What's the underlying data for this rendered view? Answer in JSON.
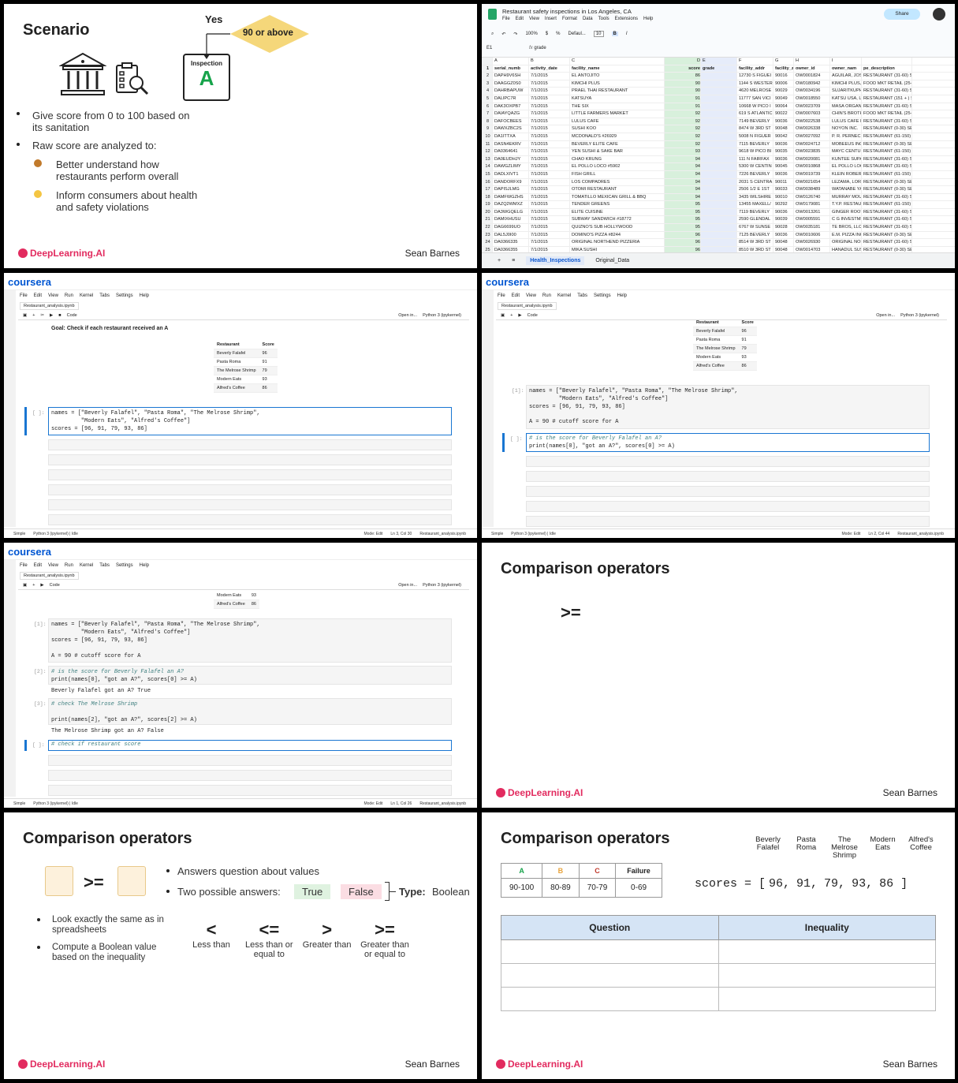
{
  "scenario": {
    "title": "Scenario",
    "yes": "Yes",
    "threshold": "90 or above",
    "inspection": "Inspection",
    "grade": "A",
    "bullets": [
      "Give score from 0 to 100 based on its sanitation",
      "Raw score are analyzed to:"
    ],
    "sub_bullets": [
      "Better understand how restaurants perform overall",
      "Inform consumers about health and safety violations"
    ],
    "logo": "DeepLearning.AI",
    "author": "Sean Barnes"
  },
  "sheet": {
    "title": "Restaurant safety inspections in Los Angeles, CA",
    "menu": [
      "File",
      "Edit",
      "View",
      "Insert",
      "Format",
      "Data",
      "Tools",
      "Extensions",
      "Help"
    ],
    "share": "Share",
    "zoom": "100%",
    "font": "Defaul...",
    "font_size": "10",
    "cell_ref": "E1",
    "formula": "grade",
    "col_letters": [
      "A",
      "B",
      "C",
      "D",
      "E",
      "F",
      "G",
      "H",
      "I"
    ],
    "headers": [
      "serial_numb",
      "activity_date",
      "facility_name",
      "score",
      "grade",
      "facility_addr",
      "facility_zip",
      "owner_id",
      "owner_nam",
      "pe_description"
    ],
    "rows": [
      [
        "DAPH9V6SH",
        "7/1/2015",
        "EL ANTOJITO",
        "86",
        "",
        "12730 S FIGUEI",
        "90016",
        "OW0001824",
        "AGUILAR, JOSE",
        "RESTAURANT (31-60) SEA"
      ],
      [
        "DAAGGZ0S0",
        "7/1/2015",
        "KIMCHI PLUS",
        "90",
        "",
        "1144 S WESTER",
        "90006",
        "OW0180942",
        "KIMCHI PLUS, I",
        "FOOD MKT RETAIL (25-1,9"
      ],
      [
        "DAHRBAPUW",
        "7/1/2015",
        "PRAEL THAI RESTAURANT",
        "90",
        "",
        "4620 MELROSE",
        "90029",
        "OW0034196",
        "SUJARITKUPH",
        "RESTAURANT (31-60) SEA"
      ],
      [
        "DALIPC7R",
        "7/1/2015",
        "KATSUYA",
        "91",
        "",
        "11777 SAN VICI",
        "90049",
        "OW0018550",
        "KATSU USA, LL",
        "RESTAURANT (151 + ) SE"
      ],
      [
        "DAK3OXPB7",
        "7/1/2015",
        "THE SIX",
        "91",
        "",
        "10668 W PICO I",
        "90064",
        "OW0023709",
        "MASA ORGANI",
        "RESTAURANT (31-60) SEA"
      ],
      [
        "DAIAYQAZG",
        "7/1/2015",
        "LITTLE FARMERS MARKET",
        "92",
        "",
        "619 S ATLANTIC",
        "90022",
        "OW0007603",
        "CHIN'S BROTHI",
        "FOOD MKT RETAIL (25-1,9"
      ],
      [
        "DAFOCBEES",
        "7/1/2015",
        "LULUS CAFE",
        "92",
        "",
        "7149 BEVERLY",
        "90036",
        "OW0022538",
        "LULUS CAFE IN",
        "RESTAURANT (31-60) SEA"
      ],
      [
        "DAWXZBC2S",
        "7/1/2015",
        "SUSHI KOO",
        "92",
        "",
        "8474 W 3RD ST",
        "90048",
        "OW0026338",
        "NOYON INC.",
        "RESTAURANT (0-30) SEAT"
      ],
      [
        "DA1ITTXA",
        "7/1/2015",
        "MCDONALD'S #26929",
        "92",
        "",
        "5008 N FIGUER",
        "90042",
        "OW0027092",
        "P. R. PERNECK",
        "RESTAURANT (61-150) SE"
      ],
      [
        "DASN4EKRV",
        "7/1/2015",
        "BEVERLY ELITE CAFE",
        "92",
        "",
        "7115 BEVERLY",
        "90036",
        "OW0024712",
        "MOBEEUS INC.",
        "RESTAURANT (0-30) SEAT"
      ],
      [
        "DA0364641",
        "7/1/2015",
        "YEN SUSHI & SAKE BAR",
        "93",
        "",
        "9618 W PICO BI",
        "90035",
        "OW0023835",
        "MAYC CENTUR",
        "RESTAURANT (61-150) SE"
      ],
      [
        "DA0EUDHJY",
        "7/1/2015",
        "CHAO KRUNG",
        "94",
        "",
        "111 N FAIRFAX",
        "90036",
        "OW0020081",
        "KUNTEE SUPA",
        "RESTAURANT (31-60) SEA"
      ],
      [
        "DAWGZLIMY",
        "7/1/2015",
        "EL POLLO LOCO #5902",
        "94",
        "",
        "5300 W CENTIN",
        "90045",
        "OW0010868",
        "EL POLLO LOC",
        "RESTAURANT (31-60) SEA"
      ],
      [
        "DADLXIVT1",
        "7/1/2015",
        "FISH GRILL",
        "94",
        "",
        "7226 BEVERLY",
        "90036",
        "OW0019739",
        "KLEIN ROBERT",
        "RESTAURANT (61-150) SE"
      ],
      [
        "DANDORFX9",
        "7/1/2015",
        "LOS COMPADRES",
        "94",
        "",
        "2031 S CENTRA",
        "90011",
        "OW0021654",
        "LEZAMA, LORE",
        "RESTAURANT (0-30) SEAT"
      ],
      [
        "DAPISJLMG",
        "7/1/2015",
        "OTOMI RESTAURANT",
        "94",
        "",
        "2506 1/2 E 1ST",
        "90033",
        "OW0038489",
        "WATANABE YAS",
        "RESTAURANT (0-30) SEAT"
      ],
      [
        "DAMFWGZHS",
        "7/1/2015",
        "TOMATILLO MEXICAN GRILL & BBQ",
        "94",
        "",
        "3435 WILSHIRE",
        "90010",
        "OW0126740",
        "MURRAY MOUI",
        "RESTAURANT (31-60) SEA"
      ],
      [
        "DAZQ2WMXZ",
        "7/1/2015",
        "TENDER GREENS",
        "95",
        "",
        "13455 MAXELL/",
        "90292",
        "OW0179081",
        "T.Y.P. RESTAUR",
        "RESTAURANT (61-150) SE"
      ],
      [
        "DA3WGQELG",
        "7/1/2015",
        "ELITE CUISINE",
        "95",
        "",
        "7119 BEVERLY",
        "90036",
        "OW0013261",
        "GINGER ROOT",
        "RESTAURANT (31-60) SEA"
      ],
      [
        "DAMIXHUSU",
        "7/1/2015",
        "SUBWAY SANDWICH #18772",
        "95",
        "",
        "2590 GLENDAL",
        "90039",
        "OW0005591",
        "C G INVESTME",
        "RESTAURANT (31-60) SEA"
      ],
      [
        "DAG6699UO",
        "7/1/2015",
        "QUIZNO'S SUB HOLLYWOOD",
        "95",
        "",
        "6767 W SUNSE",
        "90028",
        "OW0035181",
        "TE BROS, LLC",
        "RESTAURANT (31-60) SEA"
      ],
      [
        "DAL5J0I00",
        "7/1/2015",
        "DOMINO'S PIZZA #8244",
        "96",
        "",
        "7125 BEVERLY",
        "90036",
        "OW0010606",
        "E.M. PIZZA INC",
        "RESTAURANT (0-30) SEAT"
      ],
      [
        "DA0366335",
        "7/1/2015",
        "ORIGINAL NORTHEND PIZZERIA",
        "96",
        "",
        "8514 W 3RD ST",
        "90048",
        "OW0026930",
        "ORIGINAL NOR",
        "RESTAURANT (31-60) SEA"
      ],
      [
        "DA0366355",
        "7/1/2015",
        "MIKA SUSHI",
        "96",
        "",
        "8510 W 3RD ST",
        "90048",
        "OW0014703",
        "HANADUL SUSI",
        "RESTAURANT (0-30) SEAT"
      ]
    ],
    "tabs": [
      "Health_Inspections",
      "Original_Data"
    ]
  },
  "jupyter": {
    "brand": "coursera",
    "menu": [
      "File",
      "Edit",
      "View",
      "Run",
      "Kernel",
      "Tabs",
      "Settings",
      "Help"
    ],
    "tab": "Restaurant_analysis.ipynb",
    "cell_type": "Code",
    "kernel": "Python 3 (ipykernel)",
    "open_in": "Open in...",
    "status_simple": "Simple",
    "status_kernel": "Python 3 (ipykernel) | Idle",
    "status_mode": "Mode: Edit",
    "status_file": "Restaurant_analysis.ipynb",
    "goal": "Goal: Check if each restaurant received an A",
    "table_head": [
      "Restaurant",
      "Score"
    ],
    "table_rows": [
      [
        "Beverly Falafel",
        "96"
      ],
      [
        "Pasta Roma",
        "91"
      ],
      [
        "The Melrose Shrimp",
        "79"
      ],
      [
        "Modern Eats",
        "93"
      ],
      [
        "Alfred's Coffee",
        "86"
      ]
    ],
    "p3_pos": "Ln 3, Col 30",
    "p4_pos": "Ln 2, Col 44",
    "p5_pos": "Ln 1, Col 26",
    "code_names1": "names = [\"Beverly Falafel\", \"Pasta Roma\", \"The Melrose Shrimp\",",
    "code_names2": "         \"Modern Eats\", \"Alfred's Coffee\"]",
    "code_scores": "scores = [96, 91, 79, 93, 86]",
    "code_cutoff": "A = 90 # cutoff score for A",
    "code_comment1": "# is the score for Beverly Falafel an A?",
    "code_print1": "print(names[0], \"got an A?\", scores[0] >= A)",
    "out1": "Beverly Falafel got an A? True",
    "code_comment2": "# check The Melrose Shrimp",
    "code_print2": "print(names[2], \"got an A?\", scores[2] >= A)",
    "out2": "The Melrose Shrimp got an A? False",
    "code_comment3": "# check if restaurant score",
    "prompt_empty": "[ ]:",
    "prompt1": "[1]:",
    "prompt2": "[2]:",
    "prompt3": "[3]:"
  },
  "comparison": {
    "title": "Comparison operators",
    "big_op": ">=",
    "bullet1": "Answers question about values",
    "bullet2": "Two possible answers:",
    "true": "True",
    "false": "False",
    "type_label": "Type:",
    "type_value": "Boolean",
    "left1": "Look exactly the same as in spreadsheets",
    "left2": "Compute a Boolean value based on the inequality",
    "ops": [
      {
        "sym": "<",
        "cap": "Less than"
      },
      {
        "sym": "<=",
        "cap": "Less than or equal to"
      },
      {
        "sym": ">",
        "cap": "Greater than"
      },
      {
        "sym": ">=",
        "cap": "Greater than or equal to"
      }
    ],
    "grade_head": [
      "A",
      "B",
      "C",
      "Failure"
    ],
    "grade_vals": [
      "90-100",
      "80-89",
      "70-79",
      "0-69"
    ],
    "score_names": [
      "Beverly Falafel",
      "Pasta Roma",
      "The Melrose Shrimp",
      "Modern Eats",
      "Alfred's Coffee"
    ],
    "scores_label": "scores = [",
    "scores_vals": [
      "96,",
      "91,",
      "79,",
      "93,",
      "86 ]"
    ],
    "q_head": "Question",
    "i_head": "Inequality"
  },
  "colors": {
    "brand": "#e22b5f",
    "coursera": "#0056d2",
    "diamond": "#f5d77a",
    "grade_a": "#16a34a",
    "true_bg": "#dff2e0",
    "false_bg": "#fbdde3"
  }
}
